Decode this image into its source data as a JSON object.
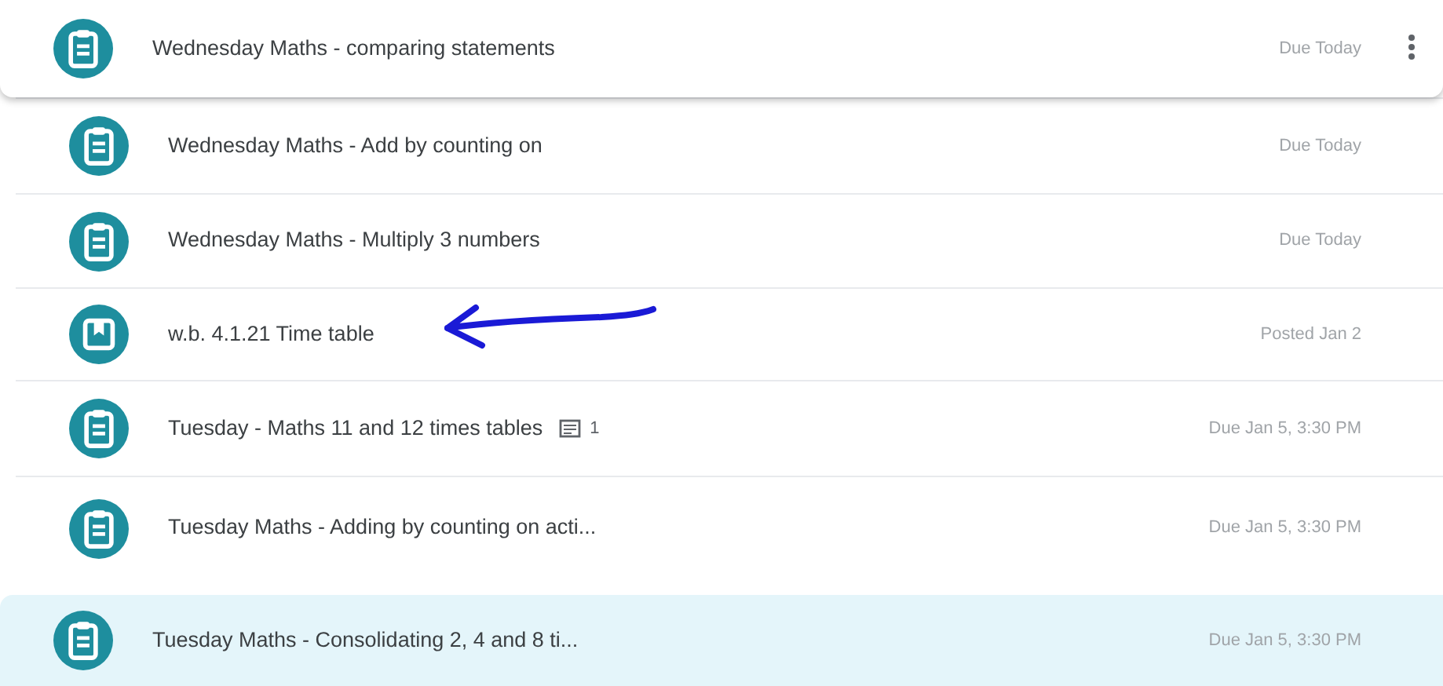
{
  "items": [
    {
      "kind": "assignment",
      "title": "Wednesday Maths - comparing statements",
      "date": "Due Today",
      "hovered": true,
      "selected": false
    },
    {
      "kind": "assignment",
      "title": "Wednesday Maths - Add by counting on",
      "date": "Due Today",
      "hovered": false,
      "selected": false
    },
    {
      "kind": "assignment",
      "title": "Wednesday Maths - Multiply 3 numbers",
      "date": "Due Today",
      "hovered": false,
      "selected": false
    },
    {
      "kind": "material",
      "title": "w.b. 4.1.21 Time table",
      "date": "Posted Jan 2",
      "hovered": false,
      "selected": false
    },
    {
      "kind": "assignment",
      "title": "Tuesday - Maths 11 and 12 times tables",
      "comments": "1",
      "date": "Due Jan 5, 3:30 PM",
      "hovered": false,
      "selected": false
    },
    {
      "kind": "assignment",
      "title": "Tuesday Maths - Adding by counting on acti...",
      "date": "Due Jan 5, 3:30 PM",
      "hovered": false,
      "selected": false
    },
    {
      "kind": "assignment",
      "title": "Tuesday Maths - Consolidating 2, 4 and 8 ti...",
      "date": "Due Jan 5, 3:30 PM",
      "hovered": false,
      "selected": true
    }
  ]
}
